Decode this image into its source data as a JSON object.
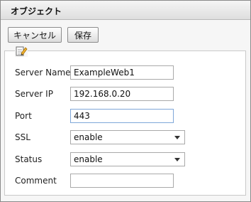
{
  "window": {
    "title": "オブジェクト"
  },
  "toolbar": {
    "cancel_label": "キャンセル",
    "save_label": "保存"
  },
  "form": {
    "legend_icon": "edit-note-icon",
    "fields": [
      {
        "label": "Server Name",
        "value": "ExampleWeb1",
        "type": "text"
      },
      {
        "label": "Server IP",
        "value": "192.168.0.20",
        "type": "text"
      },
      {
        "label": "Port",
        "value": "443",
        "type": "text"
      },
      {
        "label": "SSL",
        "value": "enable",
        "type": "select"
      },
      {
        "label": "Status",
        "value": "enable",
        "type": "select"
      },
      {
        "label": "Comment",
        "value": "",
        "type": "text"
      }
    ]
  }
}
